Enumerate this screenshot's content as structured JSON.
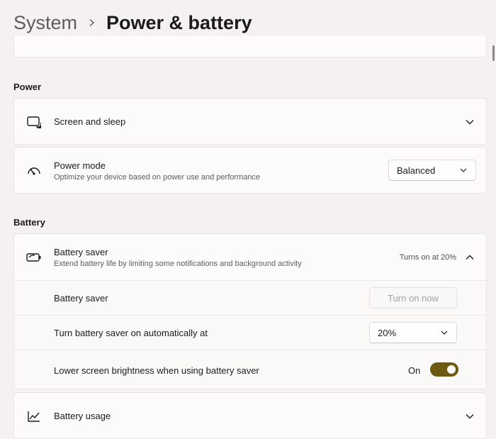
{
  "header": {
    "parent": "System",
    "current": "Power & battery"
  },
  "power_section": {
    "label": "Power",
    "screen_sleep": {
      "title": "Screen and sleep",
      "icon": "screen-sleep-icon"
    },
    "power_mode": {
      "title": "Power mode",
      "subtitle": "Optimize your device based on power use and performance",
      "value": "Balanced",
      "icon": "speedometer-icon"
    }
  },
  "battery_section": {
    "label": "Battery",
    "battery_saver": {
      "title": "Battery saver",
      "subtitle": "Extend battery life by limiting some notifications and background activity",
      "status": "Turns on at 20%",
      "icon": "battery-saver-icon",
      "rows": {
        "saver_label": "Battery saver",
        "turn_on_button": "Turn on now",
        "auto_label": "Turn battery saver on automatically at",
        "auto_value": "20%",
        "brightness_label": "Lower screen brightness when using battery saver",
        "brightness_state": "On"
      }
    },
    "battery_usage": {
      "title": "Battery usage",
      "icon": "chart-icon"
    }
  },
  "colors": {
    "accent": "#6b5a10",
    "background": "#f5f0f1",
    "card": "#fcfafa"
  }
}
